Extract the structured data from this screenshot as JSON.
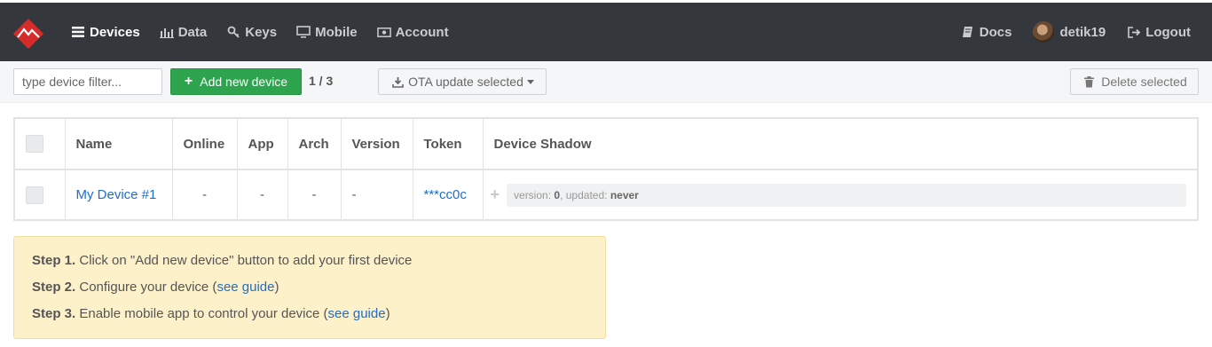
{
  "nav": {
    "items": [
      {
        "label": "Devices",
        "icon": "list-icon",
        "active": true
      },
      {
        "label": "Data",
        "icon": "bar-chart-icon",
        "active": false
      },
      {
        "label": "Keys",
        "icon": "key-icon",
        "active": false
      },
      {
        "label": "Mobile",
        "icon": "monitor-icon",
        "active": false
      },
      {
        "label": "Account",
        "icon": "money-icon",
        "active": false
      }
    ],
    "right": {
      "docs": "Docs",
      "user": "detik19",
      "logout": "Logout"
    }
  },
  "toolbar": {
    "filter_placeholder": "type device filter...",
    "add_label": "Add new device",
    "count": "1 / 3",
    "ota_label": "OTA update selected",
    "delete_label": "Delete selected"
  },
  "table": {
    "headers": [
      "Name",
      "Online",
      "App",
      "Arch",
      "Version",
      "Token",
      "Device Shadow"
    ],
    "rows": [
      {
        "name": "My Device #1",
        "online": "-",
        "app": "-",
        "arch": "-",
        "version": "-",
        "token": "***cc0c",
        "shadow_version_label": "version:",
        "shadow_version": "0",
        "shadow_updated_label": ", updated:",
        "shadow_updated": "never"
      }
    ]
  },
  "steps": [
    {
      "label": "Step 1.",
      "text": " Click on \"Add new device\" button to add your first device",
      "link": "",
      "tail": ""
    },
    {
      "label": "Step 2.",
      "text": " Configure your device (",
      "link": "see guide",
      "tail": ")"
    },
    {
      "label": "Step 3.",
      "text": " Enable mobile app to control your device (",
      "link": "see guide",
      "tail": ")"
    }
  ],
  "colors": {
    "navbar": "#34373c",
    "accent_green": "#2ea44f",
    "link": "#1e6ec8",
    "steps_bg": "#fdf1c9"
  }
}
